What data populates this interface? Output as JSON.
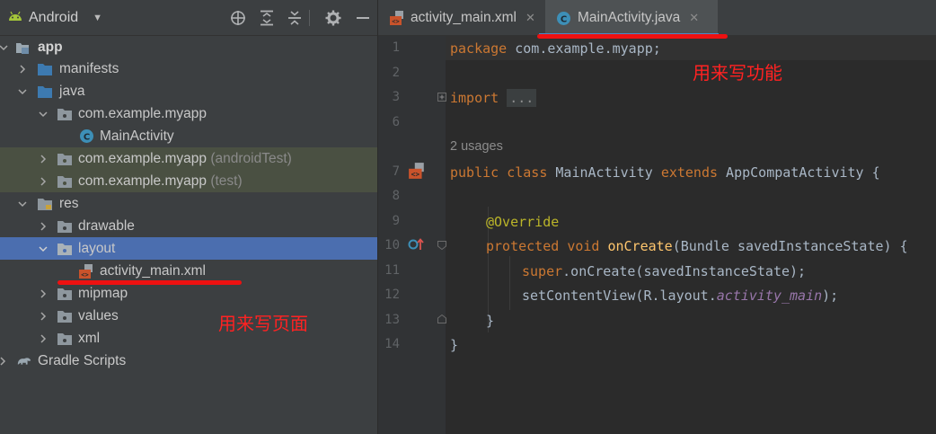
{
  "project_pane": {
    "view_name": "Android",
    "toolbar_icons": [
      "crosshair-icon",
      "expand-all-icon",
      "collapse-all-icon",
      "gear-icon",
      "minimize-icon"
    ],
    "tree": [
      {
        "label": "app",
        "hint": "",
        "icon": "module-icon",
        "expanded": true
      },
      {
        "label": "manifests",
        "hint": "",
        "icon": "folder-icon",
        "expanded": false
      },
      {
        "label": "java",
        "hint": "",
        "icon": "folder-icon",
        "expanded": true
      },
      {
        "label": "com.example.myapp",
        "hint": "",
        "icon": "package-icon",
        "expanded": true
      },
      {
        "label": "MainActivity",
        "hint": "",
        "icon": "class-icon",
        "expanded": null
      },
      {
        "label": "com.example.myapp",
        "hint": "(androidTest)",
        "icon": "package-icon",
        "expanded": false
      },
      {
        "label": "com.example.myapp",
        "hint": "(test)",
        "icon": "package-icon",
        "expanded": false
      },
      {
        "label": "res",
        "hint": "",
        "icon": "res-folder-icon",
        "expanded": true
      },
      {
        "label": "drawable",
        "hint": "",
        "icon": "package-icon",
        "expanded": false
      },
      {
        "label": "layout",
        "hint": "",
        "icon": "package-icon",
        "expanded": true
      },
      {
        "label": "activity_main.xml",
        "hint": "",
        "icon": "xml-layout-icon",
        "expanded": null
      },
      {
        "label": "mipmap",
        "hint": "",
        "icon": "package-icon",
        "expanded": false
      },
      {
        "label": "values",
        "hint": "",
        "icon": "package-icon",
        "expanded": false
      },
      {
        "label": "xml",
        "hint": "",
        "icon": "package-icon",
        "expanded": false
      },
      {
        "label": "Gradle Scripts",
        "hint": "",
        "icon": "gradle-icon",
        "expanded": false
      }
    ]
  },
  "editor": {
    "tabs": [
      {
        "label": "activity_main.xml",
        "active": false
      },
      {
        "label": "MainActivity.java",
        "active": true
      }
    ],
    "close_glyph": "✕",
    "usages_hint": "2 usages",
    "line_numbers": [
      "1",
      "2",
      "3",
      "6",
      "7",
      "8",
      "9",
      "10",
      "11",
      "12",
      "13",
      "14"
    ],
    "code": {
      "l1_kw": "package",
      "l1_rest": " com.example.myapp;",
      "l3_kw": "import",
      "l3_fold": "...",
      "l7_kw1": "public",
      "l7_kw2": "class",
      "l7_name": " MainActivity ",
      "l7_kw3": "extends",
      "l7_rest": " AppCompatActivity {",
      "l9_annotation": "@Override",
      "l10_kw1": "protected",
      "l10_kw2": "void",
      "l10_fn": "onCreate",
      "l10_rest": "(Bundle savedInstanceState) {",
      "l11_kw": "super",
      "l11_rest": ".onCreate(savedInstanceState);",
      "l12_a": "setContentView(R.layout.",
      "l12_it": "activity_main",
      "l12_b": ");",
      "l13": "}",
      "l14": "}"
    }
  },
  "annotations": {
    "java_note": "用来写功能",
    "xml_note": "用来写页面",
    "color": "#ff2222"
  }
}
